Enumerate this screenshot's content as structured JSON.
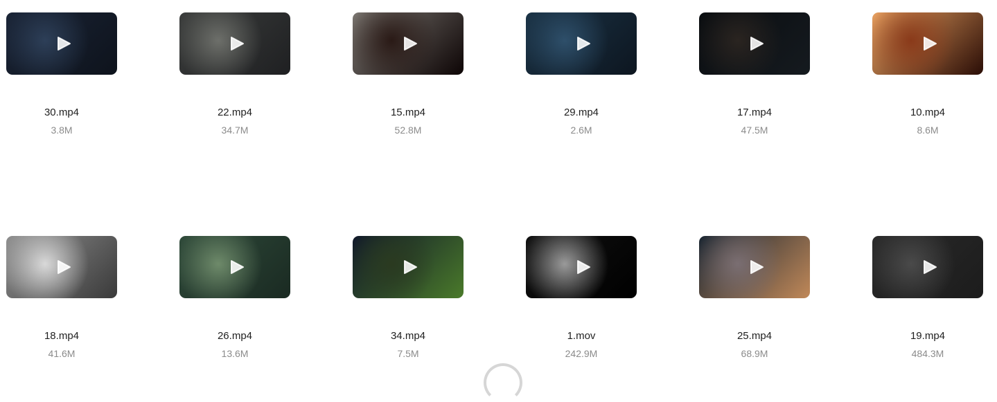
{
  "files": [
    {
      "name": "30.mp4",
      "size": "3.8M",
      "colors": [
        "#1a2436",
        "#2d3f58",
        "#0e131c"
      ]
    },
    {
      "name": "22.mp4",
      "size": "34.7M",
      "colors": [
        "#3b3d3c",
        "#6d6f6a",
        "#1f2022"
      ]
    },
    {
      "name": "15.mp4",
      "size": "52.8M",
      "colors": [
        "#7a7570",
        "#2a1a16",
        "#0d0505"
      ]
    },
    {
      "name": "29.mp4",
      "size": "2.6M",
      "colors": [
        "#1b3346",
        "#2e4f6a",
        "#0d1620"
      ]
    },
    {
      "name": "17.mp4",
      "size": "47.5M",
      "colors": [
        "#0a0d10",
        "#2a2420",
        "#151a1f"
      ]
    },
    {
      "name": "10.mp4",
      "size": "8.6M",
      "colors": [
        "#e8a060",
        "#8a3a1a",
        "#2a0d06"
      ]
    },
    {
      "name": "18.mp4",
      "size": "41.6M",
      "colors": [
        "#8f8f8f",
        "#d9d9d9",
        "#3a3a3a"
      ]
    },
    {
      "name": "26.mp4",
      "size": "13.6M",
      "colors": [
        "#2f4a3a",
        "#6e8a6a",
        "#1a2a22"
      ]
    },
    {
      "name": "34.mp4",
      "size": "7.5M",
      "colors": [
        "#10182a",
        "#2a3a20",
        "#4a7a2a"
      ]
    },
    {
      "name": "1.mov",
      "size": "242.9M",
      "colors": [
        "#111111",
        "#9a9a9a",
        "#000000"
      ]
    },
    {
      "name": "25.mp4",
      "size": "68.9M",
      "colors": [
        "#1a2632",
        "#7a6e72",
        "#c08858"
      ]
    },
    {
      "name": "19.mp4",
      "size": "484.3M",
      "colors": [
        "#2a2a2a",
        "#4a4a4a",
        "#1c1c1c"
      ]
    }
  ],
  "icons": {
    "play": "play-icon",
    "spinner": "loading-spinner"
  }
}
